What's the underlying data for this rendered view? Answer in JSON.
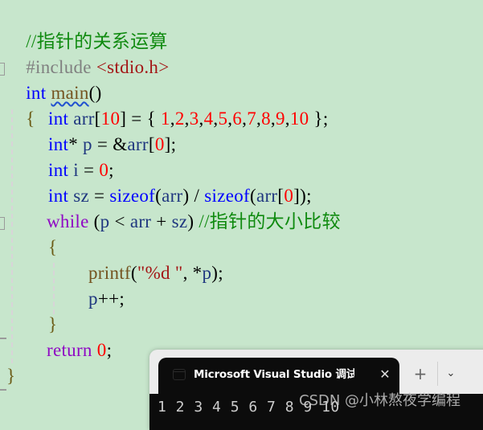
{
  "editor": {
    "lines": {
      "l1": {
        "comment": "//指针的关系运算"
      },
      "l2": {
        "directive": "#include",
        "header": "<stdio.h>"
      },
      "l3": {
        "type": "int",
        "name": "main",
        "parens": "()"
      },
      "l4": {
        "brace": "{"
      },
      "l5": {
        "type": "int",
        "rest1": " arr",
        "lb": "[",
        "size": "10",
        "rb": "]",
        "eq": " = { ",
        "values": [
          "1",
          "2",
          "3",
          "4",
          "5",
          "6",
          "7",
          "8",
          "9",
          "10"
        ],
        "end": " };"
      },
      "l6": {
        "type": "int",
        "star": "* ",
        "var": "p",
        "eq": " = &",
        "arr": "arr",
        "lb": "[",
        "idx": "0",
        "rb": "];"
      },
      "l7": {
        "type": "int",
        "var": " i",
        "eq": " = ",
        "val": "0",
        "semi": ";"
      },
      "l8": {
        "type": "int",
        "var": " sz",
        "eq": " = ",
        "fn1": "sizeof",
        "p1": "(",
        "arg1": "arr",
        "p2": ") / ",
        "fn2": "sizeof",
        "p3": "(",
        "arg2": "arr",
        "lb": "[",
        "idx": "0",
        "rb": "]);"
      },
      "l9": {
        "kw": "while",
        "p1": " (",
        "v1": "p",
        "op": " < ",
        "v2": "arr",
        "plus": " + ",
        "v3": "sz",
        "p2": ") ",
        "comment": "//指针的大小比较"
      },
      "l10": {
        "brace": "{"
      },
      "l11": {
        "fn": "printf",
        "p1": "(",
        "str": "\"%d \"",
        "comma": ", *",
        "var": "p",
        "end": ");"
      },
      "l12": {
        "var": "p",
        "end": "++;"
      },
      "l13": {
        "brace": "}"
      },
      "l14": {
        "kw": "return",
        "sp": " ",
        "val": "0",
        "semi": ";"
      },
      "l15": {
        "brace": "}"
      }
    }
  },
  "terminal": {
    "tab_title": "Microsoft Visual Studio 调试控制台",
    "close_glyph": "✕",
    "add_glyph": "+",
    "dropdown_glyph": "⌄",
    "output": "1 2 3 4 5 6 7 8 9 10"
  },
  "watermark": "CSDN @小林熬夜学编程",
  "colors": {
    "background": "#c7e6cc",
    "keyword": "#0000ff",
    "control": "#8f08c4",
    "comment": "#0f8a0f",
    "number": "#ff0000",
    "function": "#74531f",
    "variable": "#1f377f",
    "terminal_bg": "#0c0c0c"
  }
}
